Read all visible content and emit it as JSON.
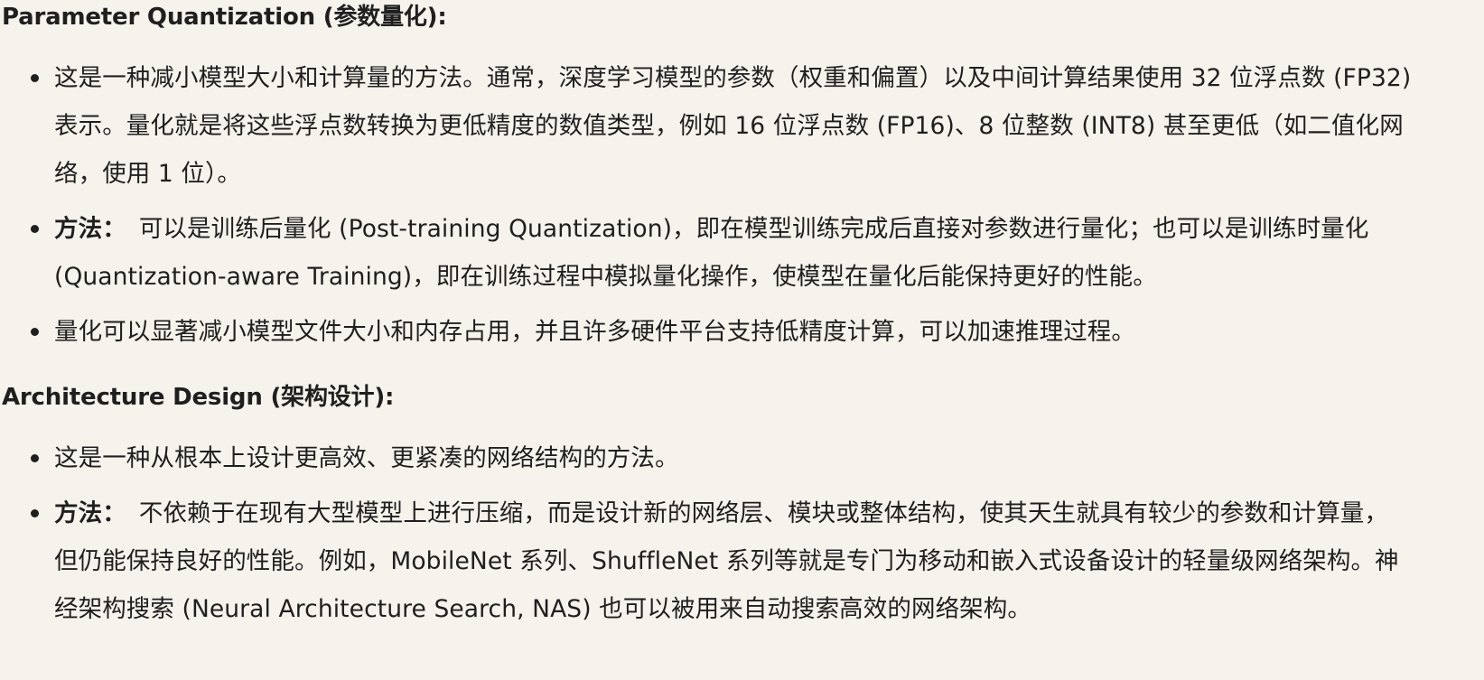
{
  "sections": [
    {
      "heading": "Parameter Quantization (参数量化):",
      "bullets": [
        {
          "label": "",
          "text": "这是一种减小模型大小和计算量的方法。通常，深度学习模型的参数（权重和偏置）以及中间计算结果使用 32 位浮点数 (FP32) 表示。量化就是将这些浮点数转换为更低精度的数值类型，例如 16 位浮点数 (FP16)、8 位整数 (INT8) 甚至更低（如二值化网络，使用 1 位）。"
        },
        {
          "label": "方法：",
          "text": "可以是训练后量化 (Post-training Quantization)，即在模型训练完成后直接对参数进行量化；也可以是训练时量化 (Quantization-aware Training)，即在训练过程中模拟量化操作，使模型在量化后能保持更好的性能。"
        },
        {
          "label": "",
          "text": "量化可以显著减小模型文件大小和内存占用，并且许多硬件平台支持低精度计算，可以加速推理过程。"
        }
      ]
    },
    {
      "heading": "Architecture Design (架构设计):",
      "bullets": [
        {
          "label": "",
          "text": "这是一种从根本上设计更高效、更紧凑的网络结构的方法。"
        },
        {
          "label": "方法：",
          "text": "不依赖于在现有大型模型上进行压缩，而是设计新的网络层、模块或整体结构，使其天生就具有较少的参数和计算量，但仍能保持良好的性能。例如，MobileNet 系列、ShuffleNet 系列等就是专门为移动和嵌入式设备设计的轻量级网络架构。神经架构搜索 (Neural Architecture Search, NAS) 也可以被用来自动搜索高效的网络架构。"
        }
      ]
    }
  ]
}
